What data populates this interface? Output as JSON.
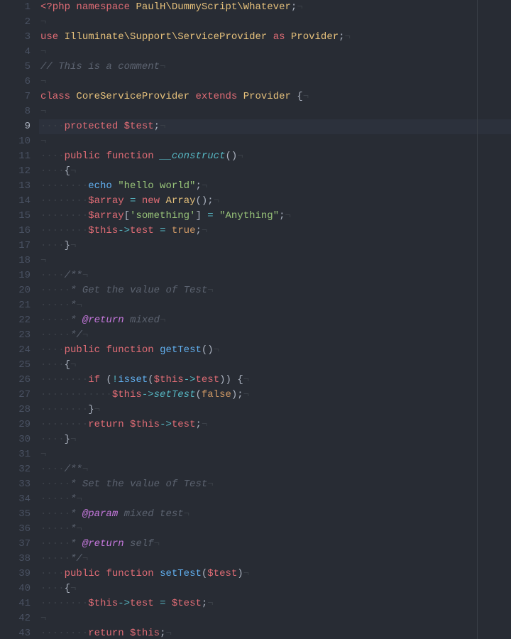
{
  "editor": {
    "active_line": 9,
    "ruler_column": 80,
    "invisibles": {
      "space": "·",
      "eol": "¬"
    },
    "colors": {
      "background": "#282c34",
      "gutter_fg": "#495162",
      "gutter_fg_active": "#abb2bf",
      "active_line_bg": "#2c313c",
      "text": "#abb2bf",
      "keyword": "#c678dd",
      "keyword2": "#e06c75",
      "class": "#e5c07b",
      "function": "#61afef",
      "magic": "#56b6c2",
      "string": "#98c379",
      "const": "#d19a66",
      "variable": "#e06c75",
      "operator": "#56b6c2",
      "comment": "#5c6370",
      "invisible": "#3b4048"
    },
    "lines": [
      {
        "n": 1,
        "tokens": [
          [
            "kw2",
            "<?php"
          ],
          [
            "punc",
            " "
          ],
          [
            "kw2",
            "namespace"
          ],
          [
            "punc",
            " "
          ],
          [
            "cls",
            "PaulH\\DummyScript\\Whatever"
          ],
          [
            "punc",
            ";"
          ],
          [
            "ws",
            "¬"
          ]
        ]
      },
      {
        "n": 2,
        "tokens": [
          [
            "ws",
            "¬"
          ]
        ]
      },
      {
        "n": 3,
        "tokens": [
          [
            "kw2",
            "use"
          ],
          [
            "punc",
            " "
          ],
          [
            "cls",
            "Illuminate\\Support\\ServiceProvider"
          ],
          [
            "punc",
            " "
          ],
          [
            "kw2",
            "as"
          ],
          [
            "punc",
            " "
          ],
          [
            "cls",
            "Provider"
          ],
          [
            "punc",
            ";"
          ],
          [
            "ws",
            "¬"
          ]
        ]
      },
      {
        "n": 4,
        "tokens": [
          [
            "ws",
            "¬"
          ]
        ]
      },
      {
        "n": 5,
        "tokens": [
          [
            "cmt",
            "// This is a comment"
          ],
          [
            "ws",
            "¬"
          ]
        ]
      },
      {
        "n": 6,
        "tokens": [
          [
            "ws",
            "¬"
          ]
        ]
      },
      {
        "n": 7,
        "tokens": [
          [
            "kw2",
            "class"
          ],
          [
            "punc",
            " "
          ],
          [
            "cls",
            "CoreServiceProvider"
          ],
          [
            "punc",
            " "
          ],
          [
            "kw2",
            "extends"
          ],
          [
            "punc",
            " "
          ],
          [
            "cls",
            "Provider"
          ],
          [
            "punc",
            " {"
          ],
          [
            "ws",
            "¬"
          ]
        ]
      },
      {
        "n": 8,
        "tokens": [
          [
            "ws",
            "¬"
          ]
        ]
      },
      {
        "n": 9,
        "tokens": [
          [
            "ws",
            "····"
          ],
          [
            "kw2",
            "protected"
          ],
          [
            "punc",
            " "
          ],
          [
            "var",
            "$test"
          ],
          [
            "punc",
            ";"
          ],
          [
            "ws",
            "¬"
          ]
        ]
      },
      {
        "n": 10,
        "tokens": [
          [
            "ws",
            "¬"
          ]
        ]
      },
      {
        "n": 11,
        "tokens": [
          [
            "ws",
            "····"
          ],
          [
            "kw2",
            "public"
          ],
          [
            "punc",
            " "
          ],
          [
            "kw2",
            "function"
          ],
          [
            "punc",
            " "
          ],
          [
            "mag",
            "__construct"
          ],
          [
            "punc",
            "()"
          ],
          [
            "ws",
            "¬"
          ]
        ]
      },
      {
        "n": 12,
        "tokens": [
          [
            "ws",
            "····"
          ],
          [
            "punc",
            "{"
          ],
          [
            "ws",
            "¬"
          ]
        ]
      },
      {
        "n": 13,
        "tokens": [
          [
            "ws",
            "········"
          ],
          [
            "fn",
            "echo"
          ],
          [
            "punc",
            " "
          ],
          [
            "str",
            "\"hello world\""
          ],
          [
            "punc",
            ";"
          ],
          [
            "ws",
            "¬"
          ]
        ]
      },
      {
        "n": 14,
        "tokens": [
          [
            "ws",
            "········"
          ],
          [
            "var",
            "$array"
          ],
          [
            "punc",
            " "
          ],
          [
            "op",
            "="
          ],
          [
            "punc",
            " "
          ],
          [
            "kw2",
            "new"
          ],
          [
            "punc",
            " "
          ],
          [
            "cls",
            "Array"
          ],
          [
            "punc",
            "();"
          ],
          [
            "ws",
            "¬"
          ]
        ]
      },
      {
        "n": 15,
        "tokens": [
          [
            "ws",
            "········"
          ],
          [
            "var",
            "$array"
          ],
          [
            "punc",
            "["
          ],
          [
            "str",
            "'something'"
          ],
          [
            "punc",
            "] "
          ],
          [
            "op",
            "="
          ],
          [
            "punc",
            " "
          ],
          [
            "str",
            "\"Anything\""
          ],
          [
            "punc",
            ";"
          ],
          [
            "ws",
            "¬"
          ]
        ]
      },
      {
        "n": 16,
        "tokens": [
          [
            "ws",
            "········"
          ],
          [
            "var",
            "$this"
          ],
          [
            "op",
            "->"
          ],
          [
            "prop",
            "test"
          ],
          [
            "punc",
            " "
          ],
          [
            "op",
            "="
          ],
          [
            "punc",
            " "
          ],
          [
            "const",
            "true"
          ],
          [
            "punc",
            ";"
          ],
          [
            "ws",
            "¬"
          ]
        ]
      },
      {
        "n": 17,
        "tokens": [
          [
            "ws",
            "····"
          ],
          [
            "punc",
            "}"
          ],
          [
            "ws",
            "¬"
          ]
        ]
      },
      {
        "n": 18,
        "tokens": [
          [
            "ws",
            "¬"
          ]
        ]
      },
      {
        "n": 19,
        "tokens": [
          [
            "ws",
            "····"
          ],
          [
            "doc",
            "/**"
          ],
          [
            "ws",
            "¬"
          ]
        ]
      },
      {
        "n": 20,
        "tokens": [
          [
            "ws",
            "·····"
          ],
          [
            "doc",
            "* Get the value of Test"
          ],
          [
            "ws",
            "¬"
          ]
        ]
      },
      {
        "n": 21,
        "tokens": [
          [
            "ws",
            "·····"
          ],
          [
            "doc",
            "*"
          ],
          [
            "ws",
            "¬"
          ]
        ]
      },
      {
        "n": 22,
        "tokens": [
          [
            "ws",
            "·····"
          ],
          [
            "doc",
            "* "
          ],
          [
            "tag",
            "@return"
          ],
          [
            "doc",
            " mixed"
          ],
          [
            "ws",
            "¬"
          ]
        ]
      },
      {
        "n": 23,
        "tokens": [
          [
            "ws",
            "·····"
          ],
          [
            "doc",
            "*/"
          ],
          [
            "ws",
            "¬"
          ]
        ]
      },
      {
        "n": 24,
        "tokens": [
          [
            "ws",
            "····"
          ],
          [
            "kw2",
            "public"
          ],
          [
            "punc",
            " "
          ],
          [
            "kw2",
            "function"
          ],
          [
            "punc",
            " "
          ],
          [
            "fn",
            "getTest"
          ],
          [
            "punc",
            "()"
          ],
          [
            "ws",
            "¬"
          ]
        ]
      },
      {
        "n": 25,
        "tokens": [
          [
            "ws",
            "····"
          ],
          [
            "punc",
            "{"
          ],
          [
            "ws",
            "¬"
          ]
        ]
      },
      {
        "n": 26,
        "tokens": [
          [
            "ws",
            "········"
          ],
          [
            "kw2",
            "if"
          ],
          [
            "punc",
            " ("
          ],
          [
            "op",
            "!"
          ],
          [
            "fn",
            "isset"
          ],
          [
            "punc",
            "("
          ],
          [
            "var",
            "$this"
          ],
          [
            "op",
            "->"
          ],
          [
            "prop",
            "test"
          ],
          [
            "punc",
            ")) {"
          ],
          [
            "ws",
            "¬"
          ]
        ]
      },
      {
        "n": 27,
        "tokens": [
          [
            "ws",
            "············"
          ],
          [
            "var",
            "$this"
          ],
          [
            "op",
            "->"
          ],
          [
            "mag",
            "setTest"
          ],
          [
            "punc",
            "("
          ],
          [
            "const",
            "false"
          ],
          [
            "punc",
            ");"
          ],
          [
            "ws",
            "¬"
          ]
        ]
      },
      {
        "n": 28,
        "tokens": [
          [
            "ws",
            "········"
          ],
          [
            "punc",
            "}"
          ],
          [
            "ws",
            "¬"
          ]
        ]
      },
      {
        "n": 29,
        "tokens": [
          [
            "ws",
            "········"
          ],
          [
            "kw2",
            "return"
          ],
          [
            "punc",
            " "
          ],
          [
            "var",
            "$this"
          ],
          [
            "op",
            "->"
          ],
          [
            "prop",
            "test"
          ],
          [
            "punc",
            ";"
          ],
          [
            "ws",
            "¬"
          ]
        ]
      },
      {
        "n": 30,
        "tokens": [
          [
            "ws",
            "····"
          ],
          [
            "punc",
            "}"
          ],
          [
            "ws",
            "¬"
          ]
        ]
      },
      {
        "n": 31,
        "tokens": [
          [
            "ws",
            "¬"
          ]
        ]
      },
      {
        "n": 32,
        "tokens": [
          [
            "ws",
            "····"
          ],
          [
            "doc",
            "/**"
          ],
          [
            "ws",
            "¬"
          ]
        ]
      },
      {
        "n": 33,
        "tokens": [
          [
            "ws",
            "·····"
          ],
          [
            "doc",
            "* Set the value of Test"
          ],
          [
            "ws",
            "¬"
          ]
        ]
      },
      {
        "n": 34,
        "tokens": [
          [
            "ws",
            "·····"
          ],
          [
            "doc",
            "*"
          ],
          [
            "ws",
            "¬"
          ]
        ]
      },
      {
        "n": 35,
        "tokens": [
          [
            "ws",
            "·····"
          ],
          [
            "doc",
            "* "
          ],
          [
            "tag",
            "@param"
          ],
          [
            "doc",
            " mixed test"
          ],
          [
            "ws",
            "¬"
          ]
        ]
      },
      {
        "n": 36,
        "tokens": [
          [
            "ws",
            "·····"
          ],
          [
            "doc",
            "*"
          ],
          [
            "ws",
            "¬"
          ]
        ]
      },
      {
        "n": 37,
        "tokens": [
          [
            "ws",
            "·····"
          ],
          [
            "doc",
            "* "
          ],
          [
            "tag",
            "@return"
          ],
          [
            "doc",
            " self"
          ],
          [
            "ws",
            "¬"
          ]
        ]
      },
      {
        "n": 38,
        "tokens": [
          [
            "ws",
            "·····"
          ],
          [
            "doc",
            "*/"
          ],
          [
            "ws",
            "¬"
          ]
        ]
      },
      {
        "n": 39,
        "tokens": [
          [
            "ws",
            "····"
          ],
          [
            "kw2",
            "public"
          ],
          [
            "punc",
            " "
          ],
          [
            "kw2",
            "function"
          ],
          [
            "punc",
            " "
          ],
          [
            "fn",
            "setTest"
          ],
          [
            "punc",
            "("
          ],
          [
            "var",
            "$test"
          ],
          [
            "punc",
            ")"
          ],
          [
            "ws",
            "¬"
          ]
        ]
      },
      {
        "n": 40,
        "tokens": [
          [
            "ws",
            "····"
          ],
          [
            "punc",
            "{"
          ],
          [
            "ws",
            "¬"
          ]
        ]
      },
      {
        "n": 41,
        "tokens": [
          [
            "ws",
            "········"
          ],
          [
            "var",
            "$this"
          ],
          [
            "op",
            "->"
          ],
          [
            "prop",
            "test"
          ],
          [
            "punc",
            " "
          ],
          [
            "op",
            "="
          ],
          [
            "punc",
            " "
          ],
          [
            "var",
            "$test"
          ],
          [
            "punc",
            ";"
          ],
          [
            "ws",
            "¬"
          ]
        ]
      },
      {
        "n": 42,
        "tokens": [
          [
            "ws",
            "¬"
          ]
        ]
      },
      {
        "n": 43,
        "tokens": [
          [
            "ws",
            "········"
          ],
          [
            "kw2",
            "return"
          ],
          [
            "punc",
            " "
          ],
          [
            "var",
            "$this"
          ],
          [
            "punc",
            ";"
          ],
          [
            "ws",
            "¬"
          ]
        ]
      }
    ]
  }
}
